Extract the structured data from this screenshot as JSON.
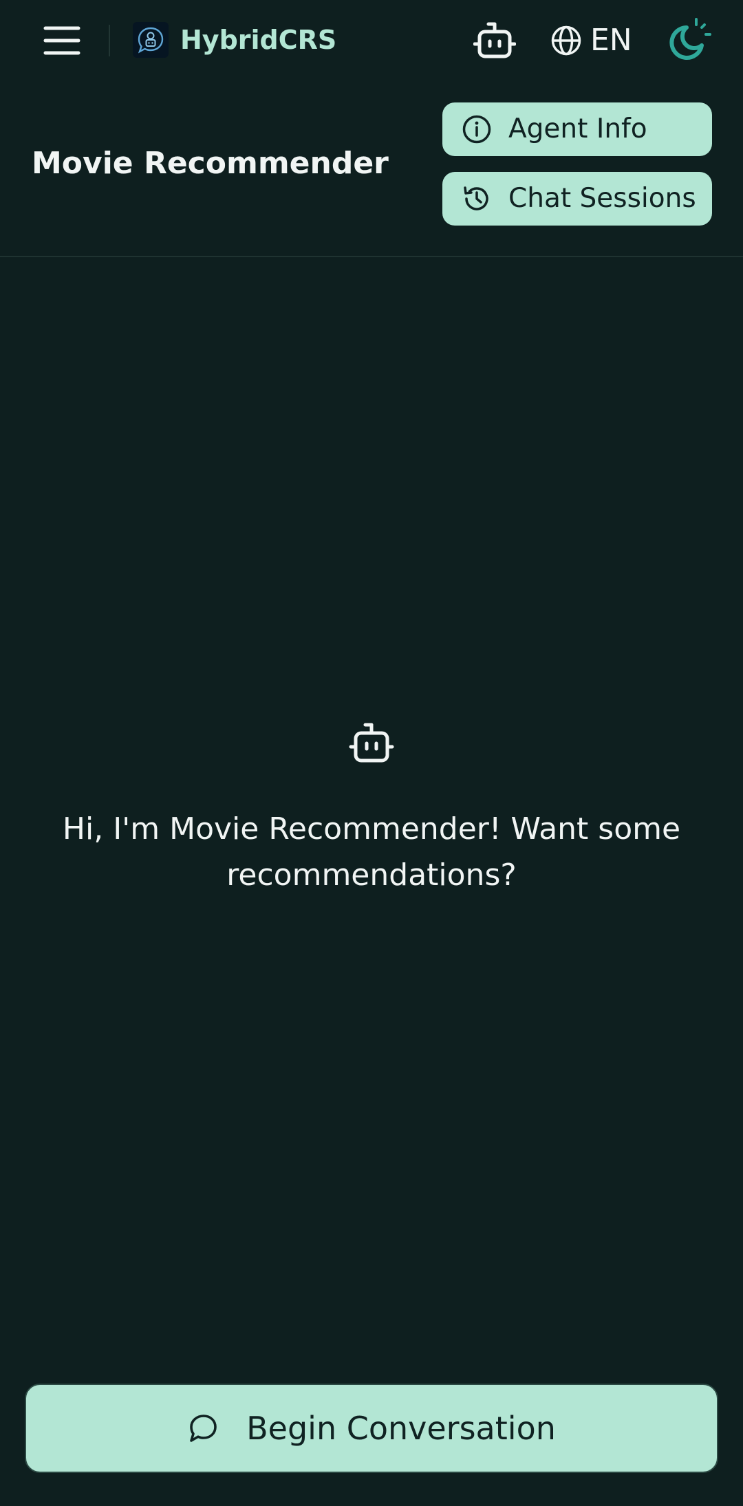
{
  "topbar": {
    "menu_icon": "hamburger-menu-icon",
    "brand_name": "HybridCRS",
    "brand_logo_icon": "robot-chat-bubble-logo",
    "agent_icon": "robot-icon",
    "language_icon": "globe-icon",
    "language": "EN",
    "theme_icon": "moon-sun-icon"
  },
  "header": {
    "title": "Movie Recommender",
    "agent_info_label": "Agent Info",
    "agent_info_icon": "info-circle-icon",
    "chat_sessions_label": "Chat Sessions",
    "chat_sessions_icon": "history-icon"
  },
  "main": {
    "empty_icon": "robot-icon",
    "greeting": "Hi, I'm Movie Recommender! Want some recommendations?"
  },
  "footer": {
    "begin_label": "Begin Conversation",
    "begin_icon": "chat-bubble-icon"
  },
  "colors": {
    "background": "#0e1f1f",
    "accent": "#b3e6d4",
    "brand_text": "#b3e6d4",
    "theme_icon": "#2fa89a",
    "button_text": "#102222"
  }
}
